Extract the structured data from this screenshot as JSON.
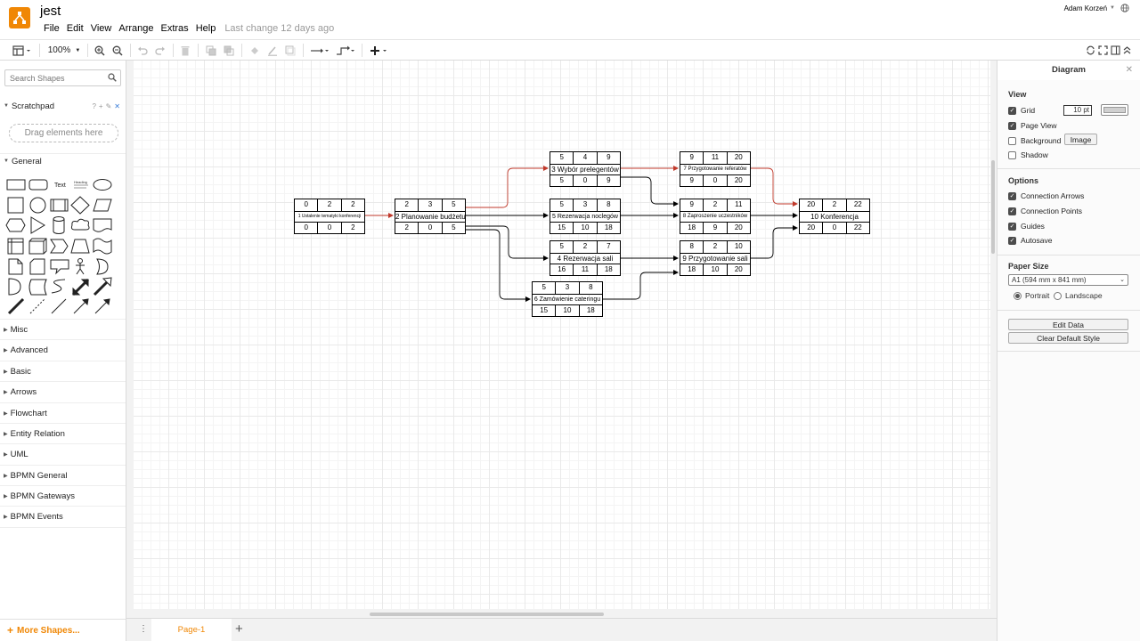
{
  "app": {
    "title": "jest",
    "menus": [
      "File",
      "Edit",
      "View",
      "Arrange",
      "Extras",
      "Help"
    ],
    "last_change": "Last change 12 days ago",
    "user": "Adam Korzeń",
    "brand_color": "#f08705"
  },
  "toolbar": {
    "zoom": "100%",
    "icons": [
      "format-panel-icon",
      "zoom-in-icon",
      "zoom-out-icon",
      "undo-icon",
      "redo-icon",
      "delete-icon",
      "to-front-icon",
      "to-back-icon",
      "fill-color-icon",
      "line-color-icon",
      "shadow-icon",
      "connection-icon",
      "waypoints-icon",
      "insert-icon",
      "fit-icon",
      "fullscreen-icon",
      "format-icon",
      "collapse-icon"
    ]
  },
  "sidebar": {
    "search_placeholder": "Search Shapes",
    "scratchpad": "Scratchpad",
    "scratchpad_hint": "Drag elements here",
    "general": "General",
    "sections": [
      "Misc",
      "Advanced",
      "Basic",
      "Arrows",
      "Flowchart",
      "Entity Relation",
      "UML",
      "BPMN General",
      "BPMN Gateways",
      "BPMN Events"
    ],
    "more_shapes": "More Shapes...",
    "shape_text_label": "Text",
    "shape_heading_label": "Heading"
  },
  "diagram": {
    "nodes": [
      {
        "id": "n1",
        "top": [
          "0",
          "2",
          "2"
        ],
        "name": "1 Ustalenie tematyki konferencji",
        "bottom": [
          "0",
          "0",
          "2"
        ]
      },
      {
        "id": "n2",
        "top": [
          "2",
          "3",
          "5"
        ],
        "name": "2 Planowanie budżetu",
        "bottom": [
          "2",
          "0",
          "5"
        ]
      },
      {
        "id": "n3",
        "top": [
          "5",
          "4",
          "9"
        ],
        "name": "3 Wybór prelegentów",
        "bottom": [
          "5",
          "0",
          "9"
        ]
      },
      {
        "id": "n5",
        "top": [
          "5",
          "3",
          "8"
        ],
        "name": "5 Rezerwacja noclegów",
        "bottom": [
          "15",
          "10",
          "18"
        ]
      },
      {
        "id": "n4",
        "top": [
          "5",
          "2",
          "7"
        ],
        "name": "4 Rezerwacja sali",
        "bottom": [
          "16",
          "11",
          "18"
        ]
      },
      {
        "id": "n6",
        "top": [
          "5",
          "3",
          "8"
        ],
        "name": "6 Zamówienie cateringu",
        "bottom": [
          "15",
          "10",
          "18"
        ]
      },
      {
        "id": "n7",
        "top": [
          "9",
          "11",
          "20"
        ],
        "name": "7 Przygotowanie referatów",
        "bottom": [
          "9",
          "0",
          "20"
        ]
      },
      {
        "id": "n8",
        "top": [
          "9",
          "2",
          "11"
        ],
        "name": "8 Zaproszenie uczestników",
        "bottom": [
          "18",
          "9",
          "20"
        ]
      },
      {
        "id": "n9",
        "top": [
          "8",
          "2",
          "10"
        ],
        "name": "9 Przygotowanie sali",
        "bottom": [
          "18",
          "10",
          "20"
        ]
      },
      {
        "id": "n10",
        "top": [
          "20",
          "2",
          "22"
        ],
        "name": "10 Konferencja",
        "bottom": [
          "20",
          "0",
          "22"
        ]
      }
    ],
    "critical_color": "#c0392b",
    "edge_color": "#000000"
  },
  "format_panel": {
    "title": "Diagram",
    "view_title": "View",
    "grid": "Grid",
    "grid_size": "10 pt",
    "page_view": "Page View",
    "background": "Background",
    "image_button": "Image",
    "shadow": "Shadow",
    "options_title": "Options",
    "connection_arrows": "Connection Arrows",
    "connection_points": "Connection Points",
    "guides": "Guides",
    "autosave": "Autosave",
    "paper_size_title": "Paper Size",
    "paper_size": "A1 (594 mm x 841 mm)",
    "portrait": "Portrait",
    "landscape": "Landscape",
    "edit_data": "Edit Data",
    "clear_default_style": "Clear Default Style"
  },
  "pages": {
    "active": "Page-1"
  }
}
